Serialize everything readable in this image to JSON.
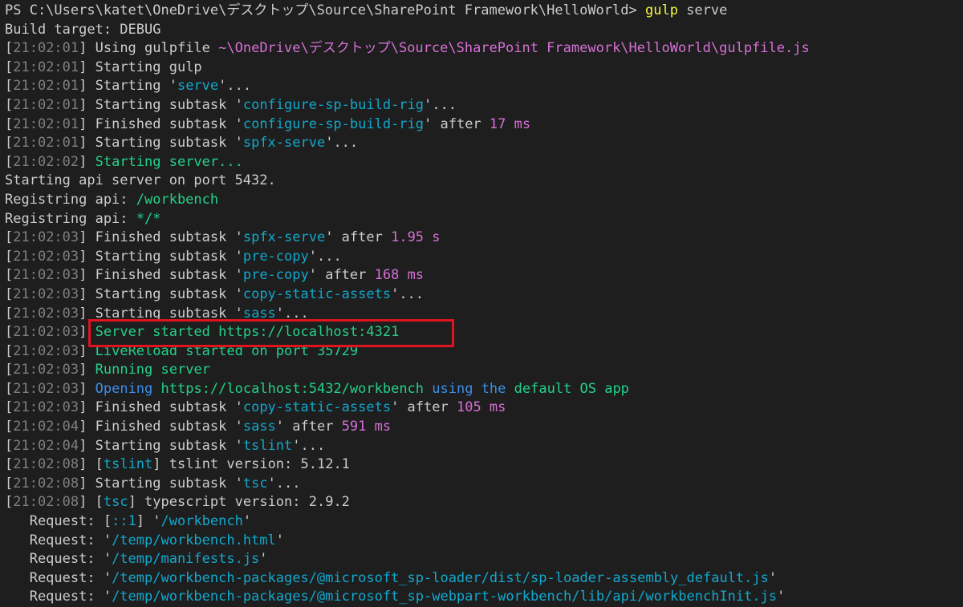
{
  "colors": {
    "background": "#1e1e1e",
    "default": "#cccccc",
    "timestamp": "#7f7f7f",
    "name": "#11a8cd",
    "number": "#d670d6",
    "success": "#23d18b",
    "info": "#3b8eea",
    "command": "#f5f543",
    "highlight": "#e0141e"
  },
  "terminal": {
    "lines": [
      {
        "name": "prompt-line",
        "segments": [
          {
            "t": "PS C:\\Users\\katet\\OneDrive\\デスクトップ\\Source\\SharePoint Framework\\HelloWorld> ",
            "c": "default"
          },
          {
            "t": "gulp",
            "c": "yellow"
          },
          {
            "t": " serve",
            "c": "default"
          }
        ]
      },
      {
        "name": "build-target-line",
        "segments": [
          {
            "t": "Build target: DEBUG",
            "c": "default"
          }
        ]
      },
      {
        "name": "log-line",
        "segments": [
          {
            "t": "[",
            "c": "default"
          },
          {
            "t": "21:02:01",
            "c": "gray"
          },
          {
            "t": "] Using gulpfile ",
            "c": "default"
          },
          {
            "t": "~\\OneDrive\\デスクトップ\\Source\\SharePoint Framework\\HelloWorld\\gulpfile.js",
            "c": "magenta"
          }
        ]
      },
      {
        "name": "log-line",
        "segments": [
          {
            "t": "[",
            "c": "default"
          },
          {
            "t": "21:02:01",
            "c": "gray"
          },
          {
            "t": "] Starting gulp",
            "c": "default"
          }
        ]
      },
      {
        "name": "log-line",
        "segments": [
          {
            "t": "[",
            "c": "default"
          },
          {
            "t": "21:02:01",
            "c": "gray"
          },
          {
            "t": "] Starting '",
            "c": "default"
          },
          {
            "t": "serve",
            "c": "cyan"
          },
          {
            "t": "'...",
            "c": "default"
          }
        ]
      },
      {
        "name": "log-line",
        "segments": [
          {
            "t": "[",
            "c": "default"
          },
          {
            "t": "21:02:01",
            "c": "gray"
          },
          {
            "t": "] Starting subtask '",
            "c": "default"
          },
          {
            "t": "configure-sp-build-rig",
            "c": "cyan"
          },
          {
            "t": "'...",
            "c": "default"
          }
        ]
      },
      {
        "name": "log-line",
        "segments": [
          {
            "t": "[",
            "c": "default"
          },
          {
            "t": "21:02:01",
            "c": "gray"
          },
          {
            "t": "] Finished subtask '",
            "c": "default"
          },
          {
            "t": "configure-sp-build-rig",
            "c": "cyan"
          },
          {
            "t": "' after ",
            "c": "default"
          },
          {
            "t": "17 ms",
            "c": "magenta"
          }
        ]
      },
      {
        "name": "log-line",
        "segments": [
          {
            "t": "[",
            "c": "default"
          },
          {
            "t": "21:02:01",
            "c": "gray"
          },
          {
            "t": "] Starting subtask '",
            "c": "default"
          },
          {
            "t": "spfx-serve",
            "c": "cyan"
          },
          {
            "t": "'...",
            "c": "default"
          }
        ]
      },
      {
        "name": "log-line",
        "segments": [
          {
            "t": "[",
            "c": "default"
          },
          {
            "t": "21:02:02",
            "c": "gray"
          },
          {
            "t": "] ",
            "c": "default"
          },
          {
            "t": "Starting server...",
            "c": "green"
          }
        ]
      },
      {
        "name": "plain-line",
        "segments": [
          {
            "t": "Starting api server on port 5432.",
            "c": "default"
          }
        ]
      },
      {
        "name": "plain-line",
        "segments": [
          {
            "t": "Registring api: ",
            "c": "default"
          },
          {
            "t": "/workbench",
            "c": "green"
          }
        ]
      },
      {
        "name": "plain-line",
        "segments": [
          {
            "t": "Registring api: ",
            "c": "default"
          },
          {
            "t": "*/*",
            "c": "green"
          }
        ]
      },
      {
        "name": "log-line",
        "segments": [
          {
            "t": "[",
            "c": "default"
          },
          {
            "t": "21:02:03",
            "c": "gray"
          },
          {
            "t": "] Finished subtask '",
            "c": "default"
          },
          {
            "t": "spfx-serve",
            "c": "cyan"
          },
          {
            "t": "' after ",
            "c": "default"
          },
          {
            "t": "1.95 s",
            "c": "magenta"
          }
        ]
      },
      {
        "name": "log-line",
        "segments": [
          {
            "t": "[",
            "c": "default"
          },
          {
            "t": "21:02:03",
            "c": "gray"
          },
          {
            "t": "] Starting subtask '",
            "c": "default"
          },
          {
            "t": "pre-copy",
            "c": "cyan"
          },
          {
            "t": "'...",
            "c": "default"
          }
        ]
      },
      {
        "name": "log-line",
        "segments": [
          {
            "t": "[",
            "c": "default"
          },
          {
            "t": "21:02:03",
            "c": "gray"
          },
          {
            "t": "] Finished subtask '",
            "c": "default"
          },
          {
            "t": "pre-copy",
            "c": "cyan"
          },
          {
            "t": "' after ",
            "c": "default"
          },
          {
            "t": "168 ms",
            "c": "magenta"
          }
        ]
      },
      {
        "name": "log-line",
        "segments": [
          {
            "t": "[",
            "c": "default"
          },
          {
            "t": "21:02:03",
            "c": "gray"
          },
          {
            "t": "] Starting subtask '",
            "c": "default"
          },
          {
            "t": "copy-static-assets",
            "c": "cyan"
          },
          {
            "t": "'...",
            "c": "default"
          }
        ]
      },
      {
        "name": "log-line",
        "segments": [
          {
            "t": "[",
            "c": "default"
          },
          {
            "t": "21:02:03",
            "c": "gray"
          },
          {
            "t": "] Starting subtask '",
            "c": "default"
          },
          {
            "t": "sass",
            "c": "cyan"
          },
          {
            "t": "'...",
            "c": "default"
          }
        ]
      },
      {
        "name": "log-line-server-started",
        "segments": [
          {
            "t": "[",
            "c": "default"
          },
          {
            "t": "21:02:03",
            "c": "gray"
          },
          {
            "t": "] ",
            "c": "default"
          },
          {
            "t": "Server started https://localhost:4321",
            "c": "green"
          }
        ]
      },
      {
        "name": "log-line",
        "segments": [
          {
            "t": "[",
            "c": "default"
          },
          {
            "t": "21:02:03",
            "c": "gray"
          },
          {
            "t": "] ",
            "c": "default"
          },
          {
            "t": "LiveReload started on port 35729",
            "c": "green"
          }
        ]
      },
      {
        "name": "log-line",
        "segments": [
          {
            "t": "[",
            "c": "default"
          },
          {
            "t": "21:02:03",
            "c": "gray"
          },
          {
            "t": "] ",
            "c": "default"
          },
          {
            "t": "Running server",
            "c": "green"
          }
        ]
      },
      {
        "name": "log-line",
        "segments": [
          {
            "t": "[",
            "c": "default"
          },
          {
            "t": "21:02:03",
            "c": "gray"
          },
          {
            "t": "] ",
            "c": "default"
          },
          {
            "t": "Opening ",
            "c": "blue"
          },
          {
            "t": "https://localhost:5432/workbench",
            "c": "green"
          },
          {
            "t": " using the ",
            "c": "blue"
          },
          {
            "t": "default OS app",
            "c": "green"
          }
        ]
      },
      {
        "name": "log-line",
        "segments": [
          {
            "t": "[",
            "c": "default"
          },
          {
            "t": "21:02:03",
            "c": "gray"
          },
          {
            "t": "] Finished subtask '",
            "c": "default"
          },
          {
            "t": "copy-static-assets",
            "c": "cyan"
          },
          {
            "t": "' after ",
            "c": "default"
          },
          {
            "t": "105 ms",
            "c": "magenta"
          }
        ]
      },
      {
        "name": "log-line",
        "segments": [
          {
            "t": "[",
            "c": "default"
          },
          {
            "t": "21:02:04",
            "c": "gray"
          },
          {
            "t": "] Finished subtask '",
            "c": "default"
          },
          {
            "t": "sass",
            "c": "cyan"
          },
          {
            "t": "' after ",
            "c": "default"
          },
          {
            "t": "591 ms",
            "c": "magenta"
          }
        ]
      },
      {
        "name": "log-line",
        "segments": [
          {
            "t": "[",
            "c": "default"
          },
          {
            "t": "21:02:04",
            "c": "gray"
          },
          {
            "t": "] Starting subtask '",
            "c": "default"
          },
          {
            "t": "tslint",
            "c": "cyan"
          },
          {
            "t": "'...",
            "c": "default"
          }
        ]
      },
      {
        "name": "log-line",
        "segments": [
          {
            "t": "[",
            "c": "default"
          },
          {
            "t": "21:02:08",
            "c": "gray"
          },
          {
            "t": "] [",
            "c": "default"
          },
          {
            "t": "tslint",
            "c": "cyan"
          },
          {
            "t": "] tslint version: 5.12.1",
            "c": "default"
          }
        ]
      },
      {
        "name": "log-line",
        "segments": [
          {
            "t": "[",
            "c": "default"
          },
          {
            "t": "21:02:08",
            "c": "gray"
          },
          {
            "t": "] Starting subtask '",
            "c": "default"
          },
          {
            "t": "tsc",
            "c": "cyan"
          },
          {
            "t": "'...",
            "c": "default"
          }
        ]
      },
      {
        "name": "log-line",
        "segments": [
          {
            "t": "[",
            "c": "default"
          },
          {
            "t": "21:02:08",
            "c": "gray"
          },
          {
            "t": "] [",
            "c": "default"
          },
          {
            "t": "tsc",
            "c": "cyan"
          },
          {
            "t": "] typescript version: 2.9.2",
            "c": "default"
          }
        ]
      },
      {
        "name": "request-line",
        "segments": [
          {
            "t": "   Request: [",
            "c": "default"
          },
          {
            "t": "::1",
            "c": "cyan"
          },
          {
            "t": "] '",
            "c": "default"
          },
          {
            "t": "/workbench",
            "c": "cyan"
          },
          {
            "t": "'",
            "c": "default"
          }
        ]
      },
      {
        "name": "request-line",
        "segments": [
          {
            "t": "   Request: '",
            "c": "default"
          },
          {
            "t": "/temp/workbench.html",
            "c": "cyan"
          },
          {
            "t": "'",
            "c": "default"
          }
        ]
      },
      {
        "name": "request-line",
        "segments": [
          {
            "t": "   Request: '",
            "c": "default"
          },
          {
            "t": "/temp/manifests.js",
            "c": "cyan"
          },
          {
            "t": "'",
            "c": "default"
          }
        ]
      },
      {
        "name": "request-line",
        "segments": [
          {
            "t": "   Request: '",
            "c": "default"
          },
          {
            "t": "/temp/workbench-packages/@microsoft_sp-loader/dist/sp-loader-assembly_default.js",
            "c": "cyan"
          },
          {
            "t": "'",
            "c": "default"
          }
        ]
      },
      {
        "name": "request-line",
        "segments": [
          {
            "t": "   Request: '",
            "c": "default"
          },
          {
            "t": "/temp/workbench-packages/@microsoft_sp-webpart-workbench/lib/api/workbenchInit.js",
            "c": "cyan"
          },
          {
            "t": "'",
            "c": "default"
          }
        ]
      }
    ]
  }
}
